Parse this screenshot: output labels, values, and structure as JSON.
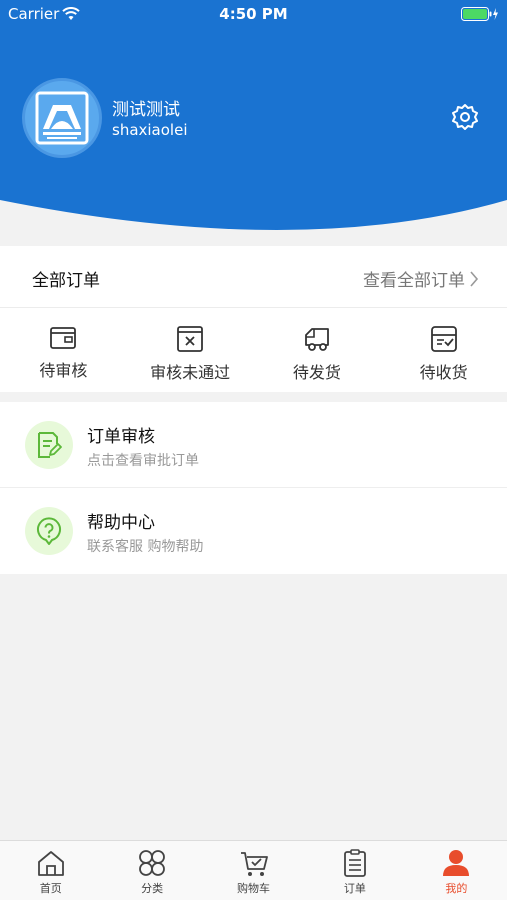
{
  "status_bar": {
    "carrier": "Carrier",
    "time": "4:50 PM"
  },
  "profile": {
    "name": "测试测试",
    "account": "shaxiaolei"
  },
  "orders": {
    "title": "全部订单",
    "view_all": "查看全部订单",
    "statuses": [
      {
        "label": "待审核",
        "icon": "wallet-icon"
      },
      {
        "label": "审核未通过",
        "icon": "rejected-box-icon"
      },
      {
        "label": "待发货",
        "icon": "truck-icon"
      },
      {
        "label": "待收货",
        "icon": "receive-box-icon"
      }
    ]
  },
  "menu": [
    {
      "title": "订单审核",
      "subtitle": "点击查看审批订单",
      "icon": "edit-document-icon"
    },
    {
      "title": "帮助中心",
      "subtitle": "联系客服 购物帮助",
      "icon": "help-icon"
    }
  ],
  "tabs": [
    {
      "label": "首页",
      "icon": "home-icon"
    },
    {
      "label": "分类",
      "icon": "category-icon"
    },
    {
      "label": "购物车",
      "icon": "cart-icon"
    },
    {
      "label": "订单",
      "icon": "order-list-icon"
    },
    {
      "label": "我的",
      "icon": "user-icon",
      "active": true
    }
  ],
  "colors": {
    "header_blue": "#1a73d1",
    "accent_orange": "#e84d2c",
    "icon_green": "#5cb83a",
    "icon_green_bg": "#e7f9d9"
  }
}
